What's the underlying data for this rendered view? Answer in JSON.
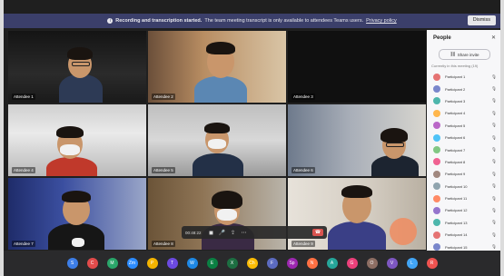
{
  "banner": {
    "title": "Recording and transcription started.",
    "text": "The team meeting transcript is only available to attendees Teams users.",
    "link": "Privacy policy",
    "dismiss": "Dismiss"
  },
  "tiles": [
    {
      "name": "Attendee 1"
    },
    {
      "name": "Attendee 2"
    },
    {
      "name": "Attendee 3"
    },
    {
      "name": "Attendee 4"
    },
    {
      "name": "Attendee 5"
    },
    {
      "name": "Attendee 6"
    },
    {
      "name": "Attendee 7"
    },
    {
      "name": "Attendee 8"
    },
    {
      "name": "Attendee 9"
    }
  ],
  "sidebar": {
    "title": "People",
    "close": "✕",
    "invite": "Share invite",
    "section": "Currently in this meeting (19)",
    "participants": [
      {
        "name": "Participant 1",
        "color": "#e57373"
      },
      {
        "name": "Participant 2",
        "color": "#7986cb"
      },
      {
        "name": "Participant 3",
        "color": "#4db6ac"
      },
      {
        "name": "Participant 4",
        "color": "#ffb74d"
      },
      {
        "name": "Participant 5",
        "color": "#ba68c8"
      },
      {
        "name": "Participant 6",
        "color": "#4fc3f7"
      },
      {
        "name": "Participant 7",
        "color": "#81c784"
      },
      {
        "name": "Participant 8",
        "color": "#f06292"
      },
      {
        "name": "Participant 9",
        "color": "#a1887f"
      },
      {
        "name": "Participant 10",
        "color": "#90a4ae"
      },
      {
        "name": "Participant 11",
        "color": "#ff8a65"
      },
      {
        "name": "Participant 12",
        "color": "#9575cd"
      },
      {
        "name": "Participant 13",
        "color": "#4db6ac"
      },
      {
        "name": "Participant 14",
        "color": "#e57373"
      },
      {
        "name": "Participant 15",
        "color": "#7986cb"
      },
      {
        "name": "Participant 16",
        "color": "#ffb74d"
      }
    ]
  },
  "controls": {
    "time": "00:48:22",
    "video": "◼",
    "mic": "🎤",
    "share": "⇪",
    "more": "⋯",
    "leave": "☎"
  },
  "dock": [
    "S",
    "C",
    "M",
    "Zm",
    "P",
    "T",
    "W",
    "E",
    "X",
    "Ch",
    "F",
    "Sp",
    "N",
    "A",
    "G",
    "O",
    "V",
    "L",
    "R"
  ]
}
